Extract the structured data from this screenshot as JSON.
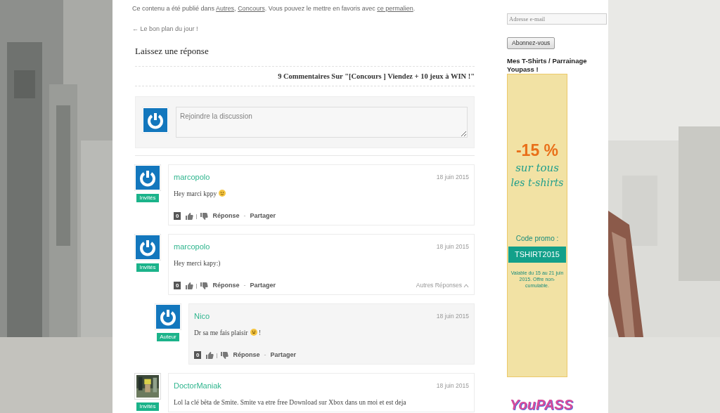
{
  "post_meta": {
    "before": "Ce contenu a été publié dans ",
    "categories": [
      "Autres",
      "Concours"
    ],
    "category_separator": ", ",
    "middle": ". Vous pouvez le mettre en favoris avec ",
    "permalink": "ce permalien",
    "after": "."
  },
  "prev_link": "← Le bon plan du jour !",
  "reply_title": "Laissez une réponse",
  "comments_heading": "9 Commentaires Sur \"[Concours ] Viendez + 10 jeux à WIN !\"",
  "new_comment": {
    "placeholder": "Rejoindre la discussion"
  },
  "comments": [
    {
      "author": "marcopolo",
      "kind": "default-avatar",
      "badge": "Invités",
      "date": "18 juin 2015",
      "text_parts": [
        {
          "kind": "text",
          "text": "Hey marci kppy"
        },
        {
          "kind": "smile"
        }
      ],
      "votes": "0",
      "reply": "Réponse",
      "separator": "-",
      "share": "Partager"
    },
    {
      "author": "marcopolo",
      "kind": "default-avatar",
      "badge": "Invités",
      "date": "18 juin 2015",
      "text_parts": [
        {
          "kind": "text",
          "text": "Hey merci kapy:)"
        }
      ],
      "votes": "0",
      "reply": "Réponse",
      "separator": "-",
      "share": "Partager",
      "more_replies": "Autres Réponses",
      "expanded": true,
      "children": [
        {
          "author": "Nico",
          "kind": "default-avatar",
          "badge": "Auteur",
          "date": "18 juin 2015",
          "text_parts": [
            {
              "kind": "text",
              "text": "Dr sa me fais plaisir"
            },
            {
              "kind": "grin"
            },
            {
              "kind": "text",
              "text": " !"
            }
          ],
          "votes": "0",
          "reply": "Réponse",
          "separator": "-",
          "share": "Partager"
        }
      ]
    },
    {
      "author": "DoctorManiak",
      "kind": "photo-avatar",
      "badge": "Invités",
      "date": "18 juin 2015",
      "text_parts": [
        {
          "kind": "text",
          "text": "Lol la clé bêta de Smite. Smite va etre free Download sur Xbox dans un moi et est deja"
        }
      ]
    }
  ],
  "sidebar": {
    "email_placeholder": "Adresse e-mail",
    "subscribe": "Abonnez-vous",
    "widget_title": "Mes T-Shirts / Parrainage Youpass !",
    "banner": {
      "discount": "-15 %",
      "line1": "sur tous",
      "line2": "les t-shirts",
      "code_label": "Code promo :",
      "code": "TSHIRT2015",
      "terms": "Valable du 15 au 21 juin 2015. Offre non-cumulable."
    },
    "logo": "YouPASS"
  }
}
